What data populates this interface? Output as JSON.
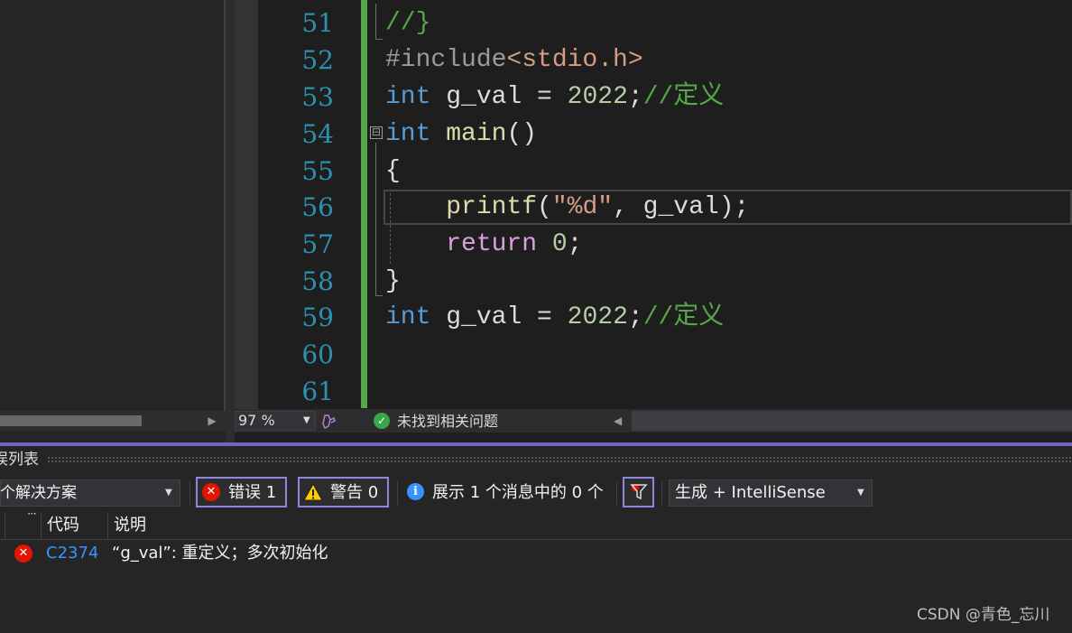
{
  "editor": {
    "lines": [
      {
        "number": "51",
        "html": "<span class=\"cmt\">//}</span>"
      },
      {
        "number": "52",
        "html": "<span class=\"pp\">#include</span><span class=\"inc\">&lt;stdio.h&gt;</span>"
      },
      {
        "number": "53",
        "html": "<span class=\"kw\">int</span> g_val = <span class=\"num\">2022</span>;<span class=\"cmt\">//定义</span>"
      },
      {
        "number": "54",
        "html": "<span class=\"kw\">int</span> <span class=\"fn\">main</span>()"
      },
      {
        "number": "55",
        "html": "{"
      },
      {
        "number": "56",
        "html": "    <span class=\"fn\">printf</span>(<span class=\"str\">\"%d\"</span>, g_val);"
      },
      {
        "number": "57",
        "html": "    <span class=\"kw2\">return</span> <span class=\"num\">0</span>;"
      },
      {
        "number": "58",
        "html": "}"
      },
      {
        "number": "59",
        "html": "<span class=\"kw\">int</span> g_val = <span class=\"num\">2022</span>;<span class=\"cmt\">//定义</span>"
      },
      {
        "number": "60",
        "html": ""
      },
      {
        "number": "61",
        "html": ""
      }
    ],
    "collapse_glyph": "⊟"
  },
  "status_bar": {
    "zoom": "97 %",
    "issues_text": "未找到相关问题"
  },
  "error_list": {
    "title": "误列表",
    "scope": "个解决方案",
    "errors_label": "错误 1",
    "warnings_label": "警告 0",
    "messages_label": "展示 1 个消息中的 0 个",
    "build_filter": "生成 + IntelliSense",
    "columns": {
      "code": "代码",
      "description": "说明"
    },
    "rows": [
      {
        "code": "C2374",
        "description": "“g_val”: 重定义；多次初始化"
      }
    ]
  },
  "watermark": "CSDN @青色_忘川",
  "colors": {
    "keyword": "#569cd6",
    "comment": "#57a64a",
    "line_number": "#2b91af",
    "error": "#e51400",
    "accent": "#8f87dc"
  }
}
